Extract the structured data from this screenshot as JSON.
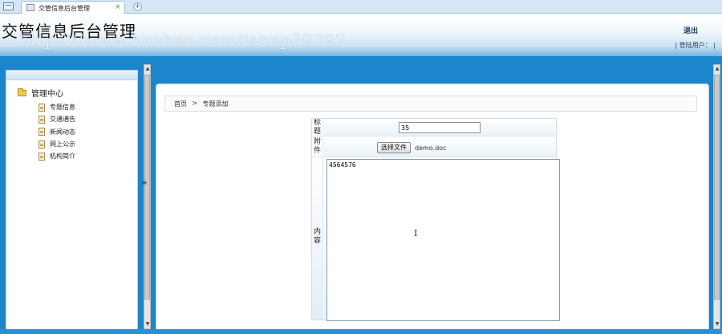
{
  "browser": {
    "tab_title": "交管信息后台管理",
    "tab_close": "×",
    "new_tab": "+"
  },
  "header": {
    "title": "交管信息后台管理",
    "watermark": "https://www.huzhan.com/ishop39397",
    "logout_label": "退出",
    "login_user_label": "| 登陆用户： |"
  },
  "sidebar": {
    "root_label": "管理中心",
    "items": [
      {
        "label": "专题信息"
      },
      {
        "label": "交通通告"
      },
      {
        "label": "新闻动态"
      },
      {
        "label": "网上公示"
      },
      {
        "label": "机构简介"
      }
    ],
    "splitter": "≡"
  },
  "breadcrumb": {
    "home": "首页",
    "separator": ">",
    "current": "专题添加"
  },
  "form": {
    "title_label": "标题",
    "title_value": "35",
    "attachment_label": "附件",
    "file_button_label": "选择文件",
    "file_name": "demo.doc",
    "content_label": "内容",
    "content_value": "4564576",
    "cursor_glyph": "I"
  },
  "colors": {
    "accent": "#1c86cc",
    "panel_border": "#b8d2e8"
  }
}
